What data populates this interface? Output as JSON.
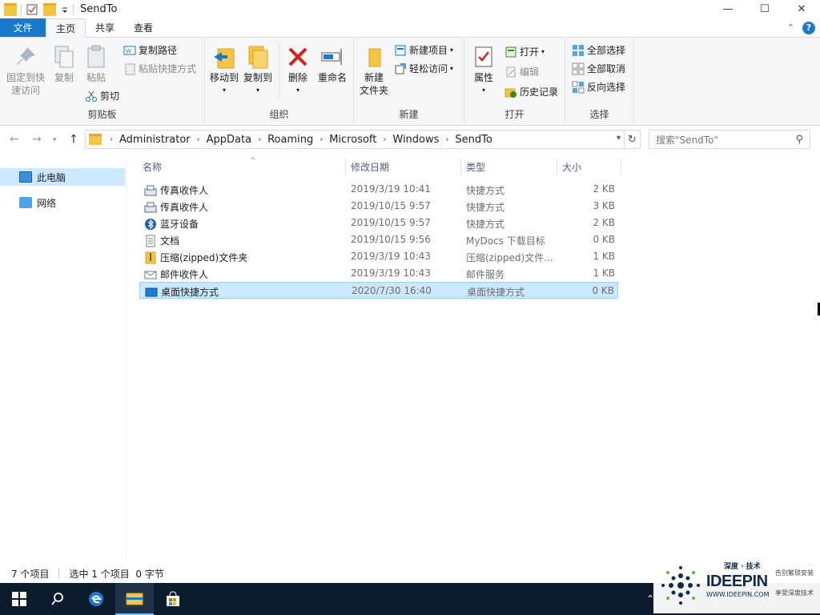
{
  "window": {
    "title": "SendTo",
    "controls": {
      "minimize": "—",
      "maximize": "☐",
      "close": "✕"
    }
  },
  "ribbon_tabs": [
    "文件",
    "主页",
    "共享",
    "查看"
  ],
  "ribbon": {
    "clipboard": {
      "group": "剪贴板",
      "pin_line1": "固定到快",
      "pin_line2": "速访问",
      "copy": "复制",
      "paste": "粘贴",
      "copy_path": "复制路径",
      "paste_shortcut": "粘贴快捷方式",
      "cut": "剪切"
    },
    "organize": {
      "group": "组织",
      "move_to": "移动到",
      "copy_to": "复制到",
      "delete": "删除",
      "rename": "重命名"
    },
    "new": {
      "group": "新建",
      "new_folder_line1": "新建",
      "new_folder_line2": "文件夹",
      "new_item": "新建项目",
      "easy_access": "轻松访问"
    },
    "open": {
      "group": "打开",
      "properties": "属性",
      "open": "打开",
      "edit": "编辑",
      "history": "历史记录"
    },
    "select": {
      "group": "选择",
      "select_all": "全部选择",
      "select_none": "全部取消",
      "invert": "反向选择"
    }
  },
  "address": {
    "crumbs": [
      "Administrator",
      "AppData",
      "Roaming",
      "Microsoft",
      "Windows",
      "SendTo"
    ],
    "search_placeholder": "搜索\"SendTo\""
  },
  "nav": {
    "items": [
      "此电脑",
      "网络"
    ]
  },
  "columns": {
    "name": "名称",
    "date": "修改日期",
    "type": "类型",
    "size": "大小"
  },
  "files": [
    {
      "name": "传真收件人",
      "date": "2019/3/19 10:41",
      "type": "快捷方式",
      "size": "2 KB",
      "icon": "fax-icon"
    },
    {
      "name": "传真收件人",
      "date": "2019/10/15 9:57",
      "type": "快捷方式",
      "size": "3 KB",
      "icon": "fax-icon"
    },
    {
      "name": "蓝牙设备",
      "date": "2019/10/15 9:57",
      "type": "快捷方式",
      "size": "2 KB",
      "icon": "bluetooth-icon"
    },
    {
      "name": "文档",
      "date": "2019/10/15 9:56",
      "type": "MyDocs 下载目标",
      "size": "0 KB",
      "icon": "documents-icon"
    },
    {
      "name": "压缩(zipped)文件夹",
      "date": "2019/3/19 10:43",
      "type": "压缩(zipped)文件...",
      "size": "1 KB",
      "icon": "zip-folder-icon"
    },
    {
      "name": "邮件收件人",
      "date": "2019/3/19 10:43",
      "type": "邮件服务",
      "size": "1 KB",
      "icon": "mail-icon"
    },
    {
      "name": "桌面快捷方式",
      "date": "2020/7/30 16:40",
      "type": "桌面快捷方式",
      "size": "0 KB",
      "icon": "desktop-icon",
      "selected": true
    }
  ],
  "status": {
    "count": "7 个项目",
    "selection": "选中 1 个项目  0 字节"
  },
  "watermark": {
    "top": "深度 · 技术",
    "logo": "IDEEPIN",
    "url": "WWW.IDEEPIN.COM",
    "line1": "告别繁琐安装",
    "line2": "享受深度技术"
  },
  "colors": {
    "accent": "#1979ca",
    "selection": "#cce8ff",
    "taskbar": "#0c1c2c"
  }
}
